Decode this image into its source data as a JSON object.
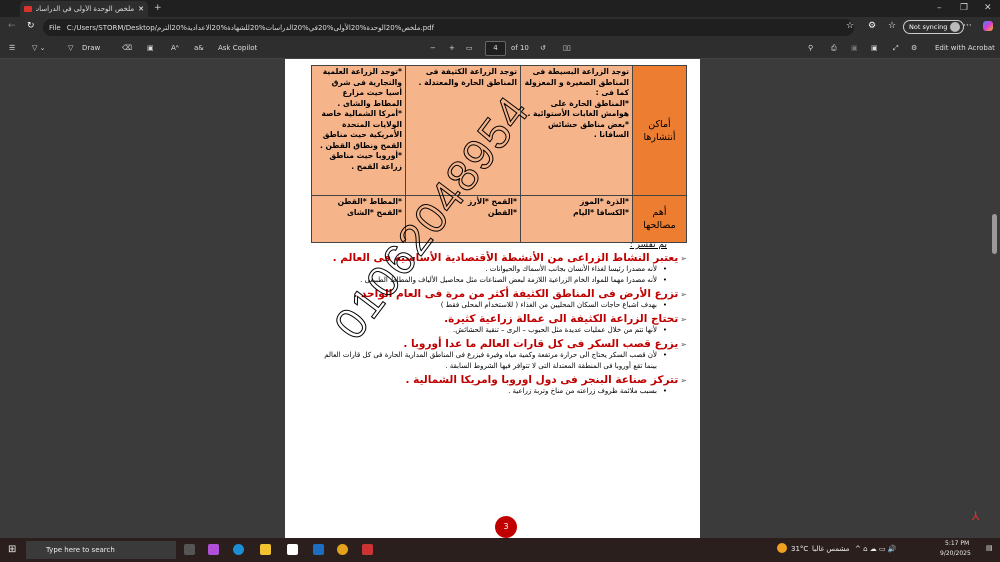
{
  "browser": {
    "tab_title": "ملخص الوحدة الأولى في الدراسات",
    "url_prefix": "File",
    "url": "C:/Users/STORM/Desktop/ملخص%20الوحدة%20الأولى%20في%20الدراسات%20للشهادة%20الاعدادية%20الترم.pdf",
    "sync_label": "Not syncing"
  },
  "toolbar": {
    "draw": "Draw",
    "ask_copilot": "Ask Copilot",
    "page": "4",
    "of": "of 10",
    "edit_acrobat": "Edit with Acrobat"
  },
  "table": {
    "rows": [
      {
        "header": "أماكن أنتشارها",
        "cells": [
          "توجد الزراعة البسيطة فى المناطق الصغيرة و المعزولة كما فى :\n*المناطق الحارة على هوامش الغابات الأستوائية .\n*بعض مناطق حشائش السافانا .",
          "توجد الزراعة الكثيفة فى المناطق الحارة والمعتدلة .",
          "*توجد الزراعة العلمية والتجارية فى شرق أسيا حيث مزارع المطاط والشاى .\n*أمركا الشمالية خاصة الولايات المتحدة الأمريكية حيث مناطق القمح ونطاق القطن .\n*أوروبا حيث مناطق زراعة القمح ."
        ]
      },
      {
        "header": "أهم مصالحها",
        "cells": [
          "*الذرة    *الموز\n*الكسافا    *اليام",
          "*القمح    *الأرز\n*القطن",
          "*المطاط    *القطن\n*القمح    *الشاى"
        ]
      }
    ]
  },
  "explain": {
    "title": "بم تفسر :",
    "items": [
      {
        "q": "يعتبر النشاط الزراعى من الأنشطة الأقتصادية الأساسية فى العالم .",
        "a": [
          "لأنه مصدرا رئيسا لغذاء الأنسان بجانب الأسماك والحيوانات .",
          "لأنه مصدرا مهما للمواد الخام الزراعية اللازمة لبعض الصناعات مثل محاصيل الألياف والمطاط الطبيعى ."
        ]
      },
      {
        "q": "تزرع الأرض فى المناطق الكثيفة أكثر من مرة فى العام الواحد .",
        "a": [
          "بهدف اشباع حاجات السكان المحليين من الغذاء ( للاستخدام المحلى فقط )"
        ]
      },
      {
        "q": "تحتاج الزراعة الكثيفة الى عمالة زراعية كثيرة.",
        "a": [
          "لأنها تتم من خلال عمليات عديدة مثل الحبوب – الرى – تنقية الحشائش."
        ]
      },
      {
        "q": "يزرع قصب السكر فى كل قارات العالم ما عدا أوروبا .",
        "a": [
          "لأن قصب السكر يحتاج الى حرارة مرتفعة وكمية مياه وفيرة فيزرع فى المناطق المدارية الحارة فى كل قارات العالم بينما تقع أوروبا فى المنطقة المعتدلة التى لا تتوافر فيها الشروط السابقة ."
        ]
      },
      {
        "q": "تتركز صناعة البنجر فى دول اوروبا وامريكا الشمالية .",
        "a": [
          "بسبب ملائمة ظروف زراعته من مناخ وتربة زراعية ."
        ]
      }
    ]
  },
  "watermark": "01062048954",
  "page_number": "3",
  "taskbar": {
    "search": "Type here to search",
    "weather": "31°C",
    "weather_desc": "مشمس غالبا",
    "time": "5:17 PM",
    "date": "9/20/2025"
  }
}
